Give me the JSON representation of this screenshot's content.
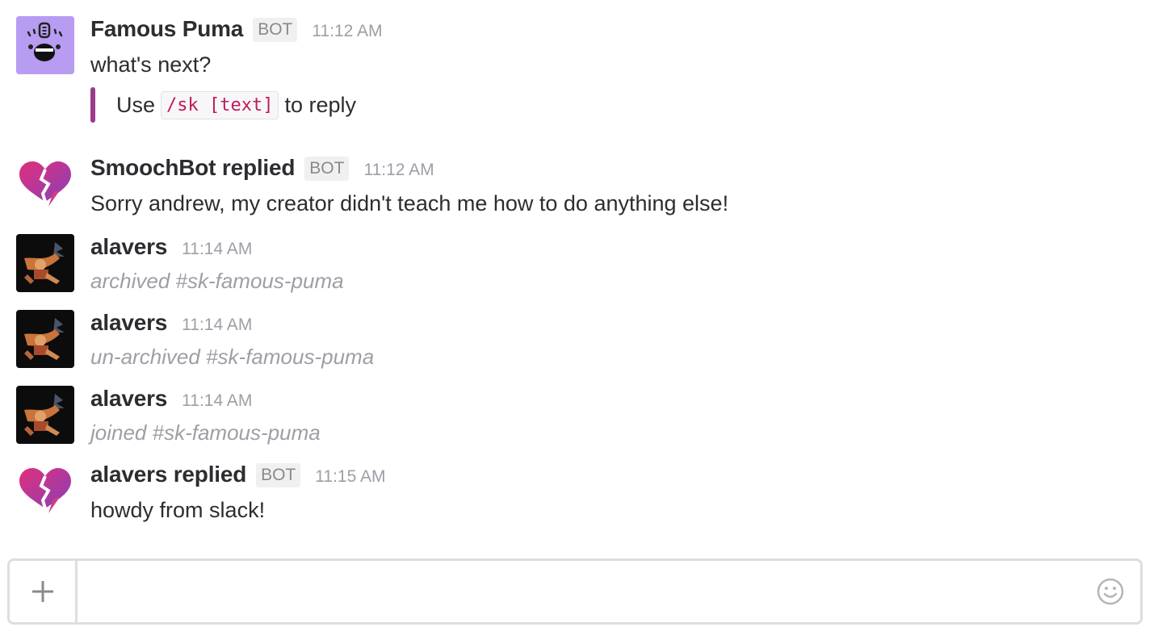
{
  "messages": [
    {
      "author": "Famous Puma",
      "badge": "BOT",
      "time": "11:12 AM",
      "avatar": "puma-bot-avatar",
      "text": "what's next?",
      "attachment": {
        "prefix": "Use",
        "code": "/sk [text]",
        "suffix": "to reply"
      }
    },
    {
      "author": "SmoochBot replied",
      "badge": "BOT",
      "time": "11:12 AM",
      "avatar": "smooch-heart-avatar",
      "text": "Sorry andrew, my creator didn't teach me how to do anything else!"
    },
    {
      "author": "alavers",
      "time": "11:14 AM",
      "avatar": "alavers-photo-avatar",
      "system": "archived #sk-famous-puma"
    },
    {
      "author": "alavers",
      "time": "11:14 AM",
      "avatar": "alavers-photo-avatar",
      "system": "un-archived #sk-famous-puma"
    },
    {
      "author": "alavers",
      "time": "11:14 AM",
      "avatar": "alavers-photo-avatar",
      "system": "joined #sk-famous-puma"
    },
    {
      "author": "alavers replied",
      "badge": "BOT",
      "time": "11:15 AM",
      "avatar": "smooch-heart-avatar",
      "text": "howdy from slack!"
    }
  ],
  "composer": {
    "placeholder": "",
    "plus_icon": "plus-icon",
    "emoji_icon": "smiley-icon"
  },
  "colors": {
    "attachment_bar": "#9b3b8c",
    "puma_avatar_bg": "#b79cf2",
    "smooch_gradient_start": "#e0307a",
    "smooch_gradient_end": "#8a3fb7",
    "code_text": "#c2185b"
  }
}
